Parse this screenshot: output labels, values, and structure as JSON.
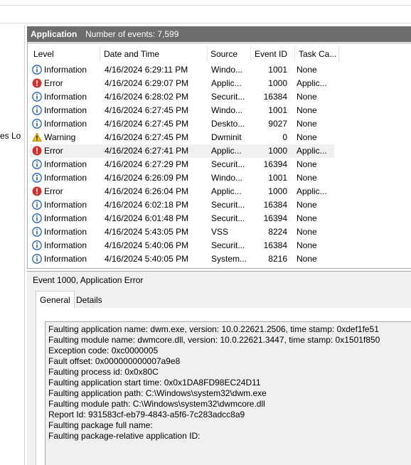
{
  "left_pane": {
    "fragment": "ces Lo"
  },
  "header": {
    "title": "Application",
    "count_label": "Number of events: 7,599"
  },
  "columns": [
    "Level",
    "Date and Time",
    "Source",
    "Event ID",
    "Task Ca..."
  ],
  "rows": [
    {
      "level": "Information",
      "date": "4/16/2024 6:29:11 PM",
      "source": "Windo...",
      "id": "1001",
      "task": "None"
    },
    {
      "level": "Error",
      "date": "4/16/2024 6:29:07 PM",
      "source": "Applic...",
      "id": "1000",
      "task": "Applic..."
    },
    {
      "level": "Information",
      "date": "4/16/2024 6:28:02 PM",
      "source": "Securit...",
      "id": "16384",
      "task": "None"
    },
    {
      "level": "Information",
      "date": "4/16/2024 6:27:45 PM",
      "source": "Windo...",
      "id": "1001",
      "task": "None"
    },
    {
      "level": "Information",
      "date": "4/16/2024 6:27:45 PM",
      "source": "Deskto...",
      "id": "9027",
      "task": "None"
    },
    {
      "level": "Warning",
      "date": "4/16/2024 6:27:45 PM",
      "source": "Dwminit",
      "id": "0",
      "task": "None"
    },
    {
      "level": "Error",
      "date": "4/16/2024 6:27:41 PM",
      "source": "Applic...",
      "id": "1000",
      "task": "Applic..."
    },
    {
      "level": "Information",
      "date": "4/16/2024 6:27:29 PM",
      "source": "Securit...",
      "id": "16394",
      "task": "None"
    },
    {
      "level": "Information",
      "date": "4/16/2024 6:26:09 PM",
      "source": "Windo...",
      "id": "1001",
      "task": "None"
    },
    {
      "level": "Error",
      "date": "4/16/2024 6:26:04 PM",
      "source": "Applic...",
      "id": "1000",
      "task": "Applic..."
    },
    {
      "level": "Information",
      "date": "4/16/2024 6:02:18 PM",
      "source": "Securit...",
      "id": "16384",
      "task": "None"
    },
    {
      "level": "Information",
      "date": "4/16/2024 6:01:48 PM",
      "source": "Securit...",
      "id": "16394",
      "task": "None"
    },
    {
      "level": "Information",
      "date": "4/16/2024 5:43:05 PM",
      "source": "VSS",
      "id": "8224",
      "task": "None"
    },
    {
      "level": "Information",
      "date": "4/16/2024 5:40:06 PM",
      "source": "Securit...",
      "id": "16384",
      "task": "None"
    },
    {
      "level": "Information",
      "date": "4/16/2024 5:40:05 PM",
      "source": "System...",
      "id": "8216",
      "task": "None"
    }
  ],
  "selected_row": 6,
  "event_title": "Event 1000, Application Error",
  "tabs": [
    "General",
    "Details"
  ],
  "description": [
    "Faulting application name: dwm.exe, version: 10.0.22621.2506, time stamp: 0xdef1fe51",
    "Faulting module name: dwmcore.dll, version: 10.0.22621.3447, time stamp: 0x1501f850",
    "Exception code: 0xc0000005",
    "Fault offset: 0x000000000007a9e8",
    "Faulting process id: 0x0x80C",
    "Faulting application start time: 0x0x1DA8FD98EC24D11",
    "Faulting application path: C:\\Windows\\system32\\dwm.exe",
    "Faulting module path: C:\\Windows\\system32\\dwmcore.dll",
    "Report Id: 931583cf-eb79-4843-a5f6-7c283adcc8a9",
    "Faulting package full name:",
    "Faulting package-relative application ID:"
  ],
  "colors": {
    "header_bg": "#6d6d6d",
    "info": "#1f5fbf",
    "error": "#d32f2f",
    "warning": "#f5c400"
  }
}
